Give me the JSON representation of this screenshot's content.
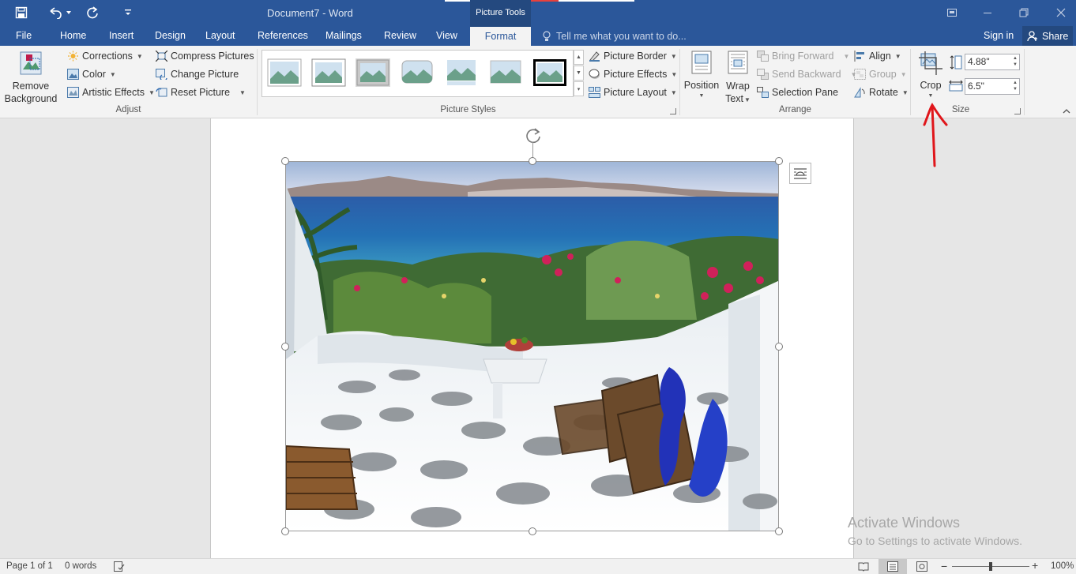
{
  "titlebar": {
    "doc_title": "Document7 - Word",
    "context_tab_header": "Picture Tools",
    "quick_access": [
      "save-icon",
      "undo-icon",
      "redo-icon",
      "customize-icon"
    ]
  },
  "tabs": [
    {
      "label": "File"
    },
    {
      "label": "Home"
    },
    {
      "label": "Insert"
    },
    {
      "label": "Design"
    },
    {
      "label": "Layout"
    },
    {
      "label": "References"
    },
    {
      "label": "Mailings"
    },
    {
      "label": "Review"
    },
    {
      "label": "View"
    },
    {
      "label": "Format",
      "active": true
    }
  ],
  "tell_me": "Tell me what you want to do...",
  "sign_in": "Sign in",
  "share": "Share",
  "ribbon": {
    "adjust": {
      "remove_bg_line1": "Remove",
      "remove_bg_line2": "Background",
      "corrections": "Corrections",
      "color": "Color",
      "artistic_effects": "Artistic Effects",
      "compress": "Compress Pictures",
      "change": "Change Picture",
      "reset": "Reset Picture",
      "label": "Adjust"
    },
    "styles": {
      "border": "Picture Border",
      "effects": "Picture Effects",
      "layout": "Picture Layout",
      "label": "Picture Styles"
    },
    "arrange": {
      "position": "Position",
      "wrap_line1": "Wrap",
      "wrap_line2": "Text",
      "bring_forward": "Bring Forward",
      "send_backward": "Send Backward",
      "selection_pane": "Selection Pane",
      "align": "Align",
      "group": "Group",
      "rotate": "Rotate",
      "label": "Arrange"
    },
    "size": {
      "crop": "Crop",
      "height": "4.88\"",
      "width": "6.5\"",
      "label": "Size"
    }
  },
  "watermark": {
    "line1": "Activate Windows",
    "line2": "Go to Settings to activate Windows."
  },
  "status": {
    "page": "Page 1 of 1",
    "words": "0 words",
    "zoom": "100%",
    "zoom_level_percent": 100
  },
  "colors": {
    "brand": "#2b579a",
    "annotation": "#e0161b"
  }
}
